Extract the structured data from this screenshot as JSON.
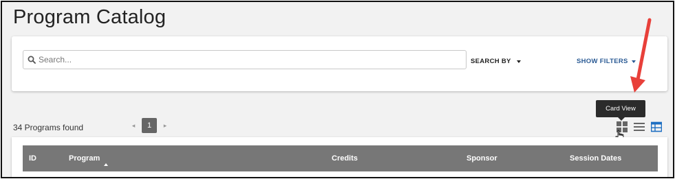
{
  "page": {
    "title": "Program Catalog"
  },
  "search": {
    "placeholder": "Search...",
    "search_by_label": "SEARCH BY",
    "show_filters_label": "SHOW FILTERS"
  },
  "results": {
    "count_text": "34 Programs found",
    "current_page": "1"
  },
  "views": {
    "tooltip": "Card View",
    "active_color": "#1e6fc2",
    "items": [
      {
        "icon": "card-view-icon"
      },
      {
        "icon": "list-view-icon"
      },
      {
        "icon": "table-view-icon"
      }
    ]
  },
  "table": {
    "columns": [
      "ID",
      "Program",
      "Credits",
      "Sponsor",
      "Session Dates"
    ],
    "sorted_column": "Program",
    "sort_direction": "ascending"
  },
  "colors": {
    "header_bg": "#777777",
    "link": "#2a5a94",
    "annotation_arrow": "#e8403a"
  }
}
